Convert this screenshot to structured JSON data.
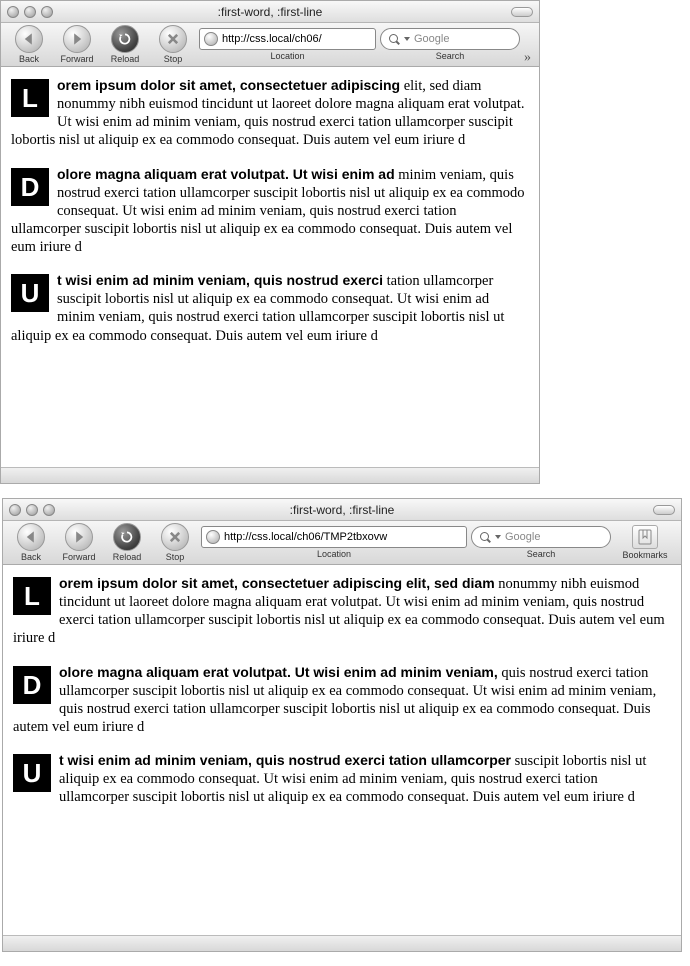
{
  "common": {
    "window_title": ":first-word, :first-line",
    "toolbar": {
      "back": "Back",
      "forward": "Forward",
      "reload": "Reload",
      "stop": "Stop",
      "location": "Location",
      "search": "Search",
      "bookmarks": "Bookmarks",
      "search_placeholder": "Google"
    }
  },
  "win1": {
    "url": "http://css.local/ch06/",
    "paragraphs": [
      {
        "cap": "L",
        "bold": "orem ipsum dolor sit amet, consectetuer adipiscing",
        "rest": " elit, sed diam nonummy nibh euismod tincidunt ut laoreet dolore magna aliquam erat volutpat. Ut wisi enim ad minim veniam, quis nostrud exerci tation ullamcorper suscipit lobortis nisl ut aliquip ex ea commodo consequat. Duis autem vel eum iriure d"
      },
      {
        "cap": "D",
        "bold": "olore magna aliquam erat volutpat. Ut wisi enim ad",
        "rest": " minim veniam, quis nostrud exerci tation ullamcorper suscipit lobortis nisl ut aliquip ex ea commodo consequat. Ut wisi enim ad minim veniam, quis nostrud exerci tation ullamcorper suscipit lobortis nisl ut aliquip ex ea commodo consequat. Duis autem vel eum iriure d"
      },
      {
        "cap": "U",
        "bold": "t wisi enim ad minim veniam, quis nostrud exerci",
        "rest": " tation ullamcorper suscipit lobortis nisl ut aliquip ex ea commodo consequat. Ut wisi enim ad minim veniam, quis nostrud exerci tation ullamcorper suscipit lobortis nisl ut aliquip ex ea commodo consequat. Duis autem vel eum iriure d"
      }
    ]
  },
  "win2": {
    "url": "http://css.local/ch06/TMP2tbxovw",
    "paragraphs": [
      {
        "cap": "L",
        "bold": "orem ipsum dolor sit amet, consectetuer adipiscing elit, sed diam",
        "rest": " nonummy nibh euismod tincidunt ut laoreet dolore magna aliquam erat volutpat. Ut wisi enim ad minim veniam, quis nostrud exerci tation ullamcorper suscipit lobortis nisl ut aliquip ex ea commodo consequat. Duis autem vel eum iriure d"
      },
      {
        "cap": "D",
        "bold": "olore magna aliquam erat volutpat. Ut wisi enim ad minim veniam,",
        "rest": " quis nostrud exerci tation ullamcorper suscipit lobortis nisl ut aliquip ex ea commodo consequat. Ut wisi enim ad minim veniam, quis nostrud exerci tation ullamcorper suscipit lobortis nisl ut aliquip ex ea commodo consequat. Duis autem vel eum iriure d"
      },
      {
        "cap": "U",
        "bold": "t wisi enim ad minim veniam, quis nostrud exerci tation ullamcorper",
        "rest": " suscipit lobortis nisl ut aliquip ex ea commodo consequat. Ut wisi enim ad minim veniam, quis nostrud exerci tation ullamcorper suscipit lobortis nisl ut aliquip ex ea commodo consequat. Duis autem vel eum iriure d"
      }
    ]
  }
}
